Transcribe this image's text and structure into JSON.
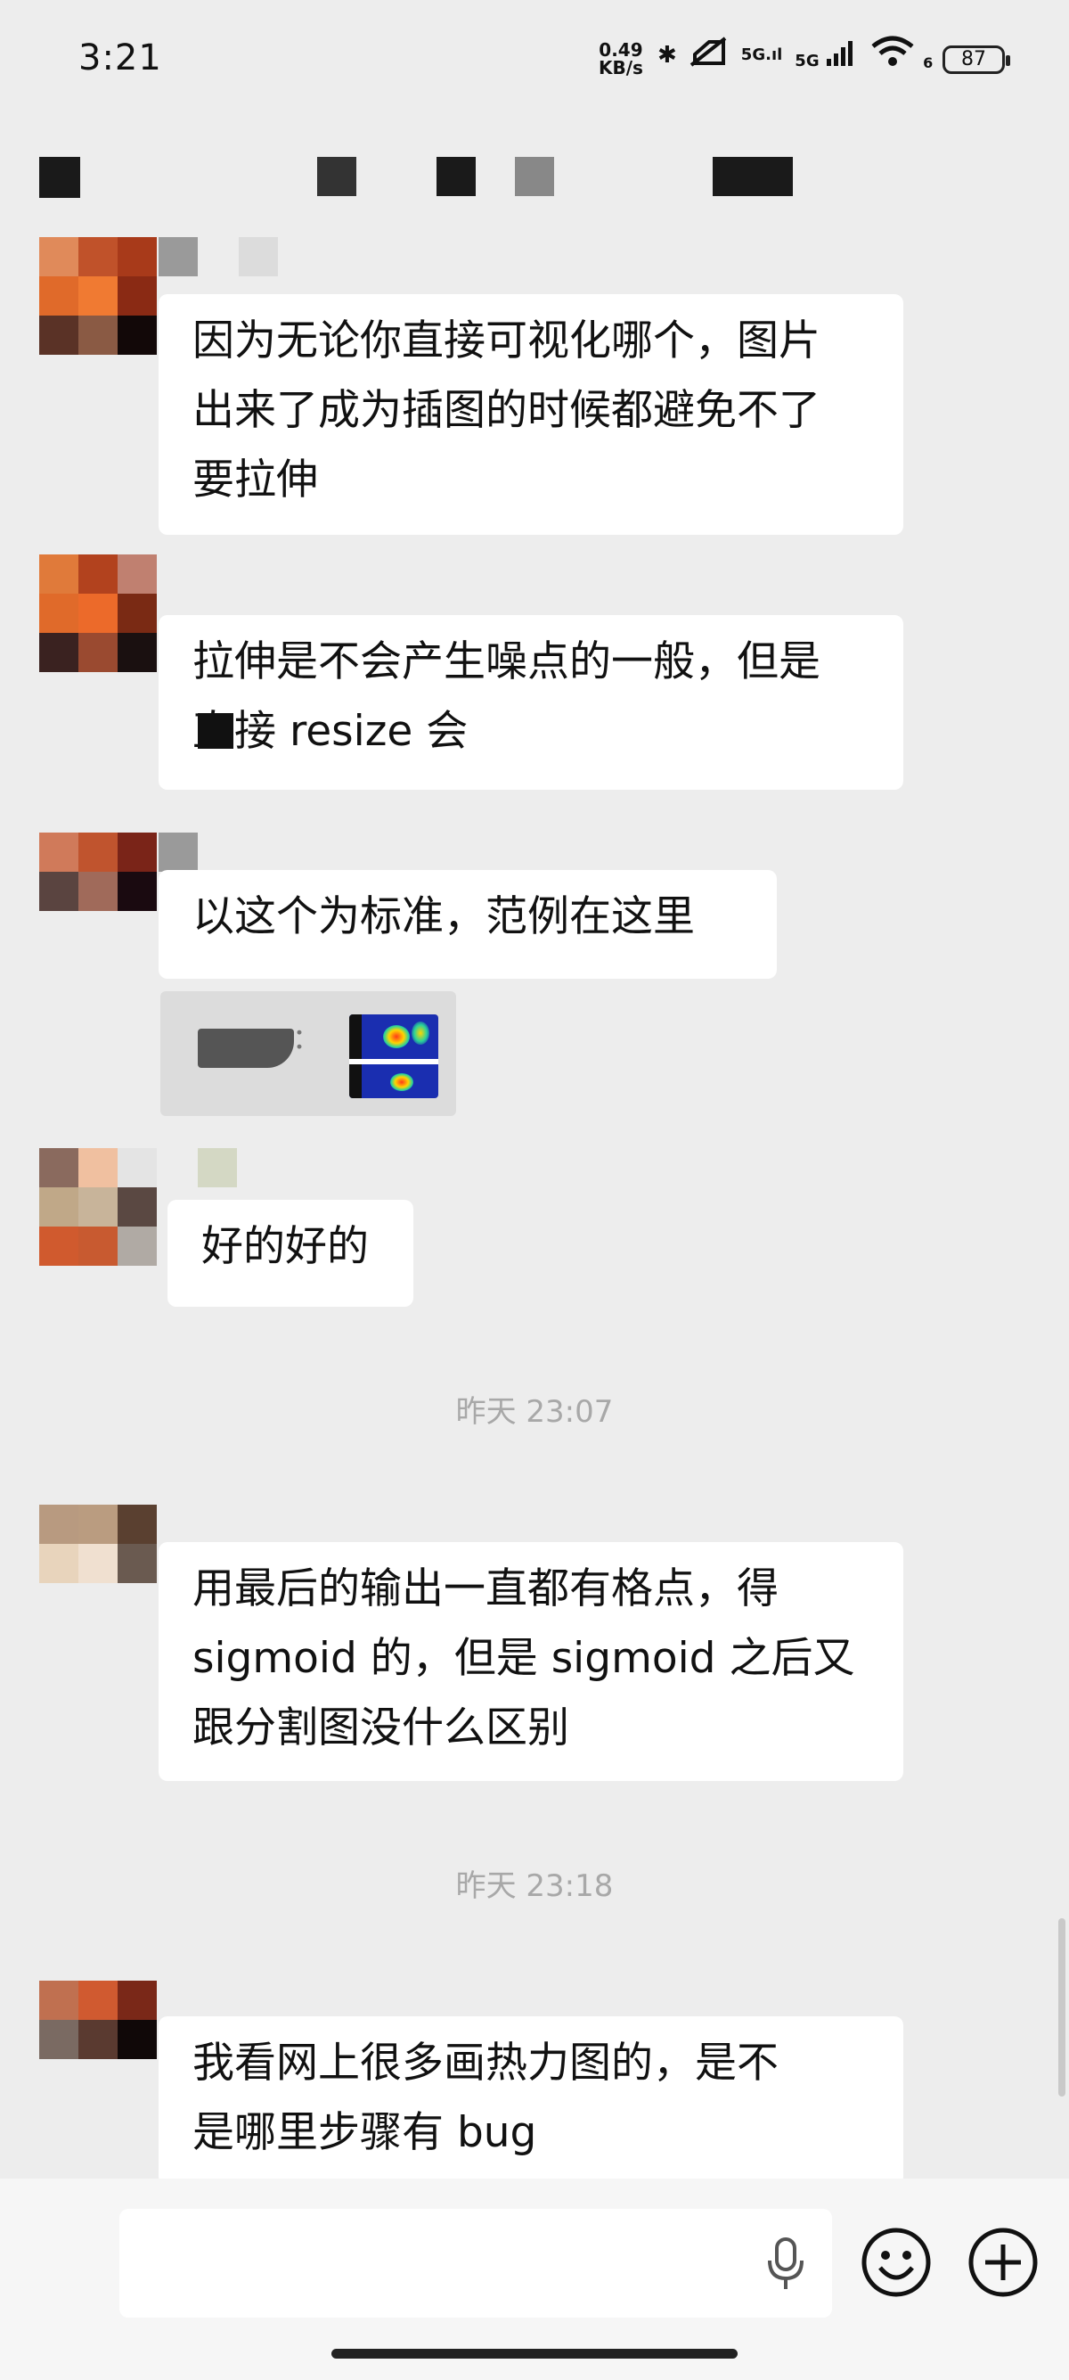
{
  "status_bar": {
    "time": "3:21",
    "net_speed_value": "0.49",
    "net_speed_unit": "KB/s",
    "signal_1": "5G",
    "signal_2": "5G",
    "wifi_sub": "6",
    "battery": "87"
  },
  "messages": [
    {
      "text": "因为无论你直接可视化哪个，图片\n出来了成为插图的时候都避免不了\n要拉伸"
    },
    {
      "text": "拉伸是不会产生噪点的一般，但是\n直接 resize 会"
    },
    {
      "text": "以这个为标准，范例在这里"
    },
    {
      "text": "好的好的"
    },
    {
      "text": "用最后的输出一直都有格点，得\nsigmoid 的，但是 sigmoid 之后又\n跟分割图没什么区别"
    },
    {
      "text": "我看网上很多画热力图的，是不\n是哪里步骤有 bug"
    }
  ],
  "quote": {
    "colon": "："
  },
  "timestamps": [
    "昨天 23:07",
    "昨天 23:18"
  ],
  "icons": [
    "bluetooth-icon",
    "mute-icon",
    "signal-icon",
    "wifi-icon",
    "battery-icon",
    "mic-icon",
    "emoji-icon",
    "plus-icon"
  ]
}
